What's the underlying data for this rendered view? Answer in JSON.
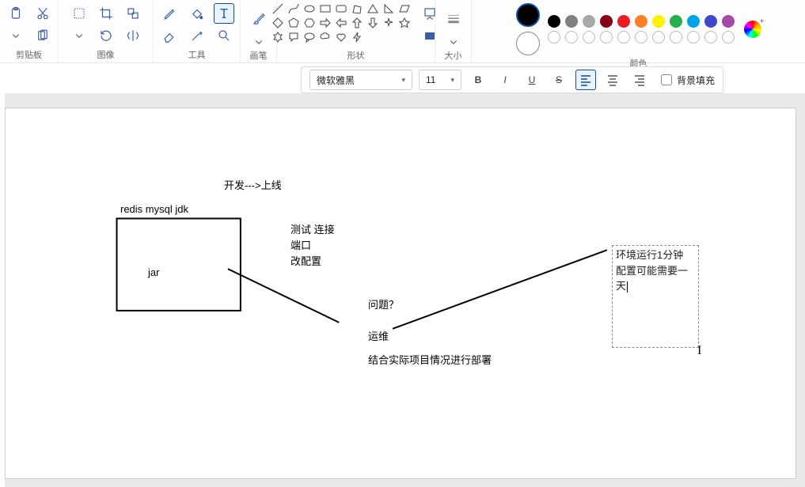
{
  "ribbon": {
    "clipboard": {
      "label": "剪贴板"
    },
    "image": {
      "label": "图像"
    },
    "tools": {
      "label": "工具"
    },
    "brush": {
      "label": "画笔"
    },
    "shapes": {
      "label": "形状"
    },
    "size": {
      "label": "大小"
    },
    "color": {
      "label": "颜色"
    }
  },
  "palette": {
    "primary": "#000000",
    "secondary": "#ffffff",
    "row1": [
      "#000000",
      "#7f7f7f",
      "#a8a8a8",
      "#880015",
      "#ed1c24",
      "#ff7f27",
      "#fff200",
      "#22b14c",
      "#00a2e8",
      "#3f48cc",
      "#a349a4"
    ],
    "row2_outline_count": 11
  },
  "textbar": {
    "font": "微软雅黑",
    "size": "11",
    "bold": "B",
    "italic": "I",
    "underline": "U",
    "strike": "S",
    "bg_fill_label": "背景填充"
  },
  "canvas": {
    "t_dev": "开发--->上线",
    "t_stack": "redis  mysql  jdk",
    "t_jar": "jar",
    "t_test": "测试  连接",
    "t_port": "端口",
    "t_conf": "改配置",
    "t_q": "问题？",
    "t_ops": "运维",
    "t_dep": "结合实际项目情况进行部署",
    "edit_l1": "环境运行1分钟",
    "edit_l2": "配置可能需要一天"
  }
}
